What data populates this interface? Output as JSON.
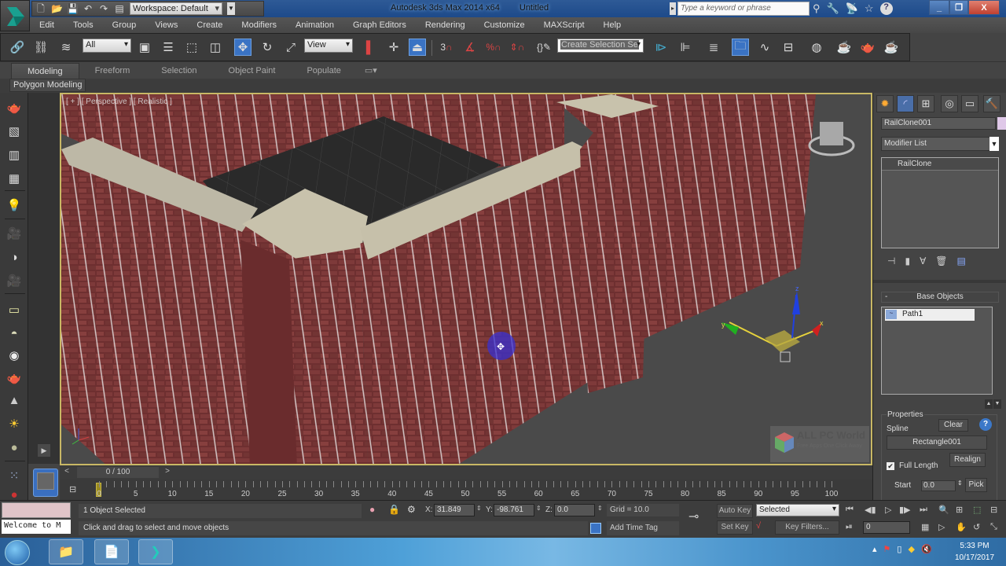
{
  "titlebar": {
    "app_title": "Autodesk 3ds Max  2014 x64",
    "document": "Untitled",
    "workspace": "Workspace: Default",
    "search_placeholder": "Type a keyword or phrase",
    "quick_access": [
      "new-icon",
      "open-icon",
      "save-icon",
      "undo-icon",
      "redo-icon",
      "project-folder-icon"
    ],
    "info_icons": [
      "binoculars-icon",
      "wrench-icon",
      "satellite-icon",
      "star-icon",
      "help-icon"
    ],
    "window_buttons": {
      "minimize": "_",
      "restore": "❐",
      "close": "X"
    }
  },
  "menubar": {
    "items": [
      "Edit",
      "Tools",
      "Group",
      "Views",
      "Create",
      "Modifiers",
      "Animation",
      "Graph Editors",
      "Rendering",
      "Customize",
      "MAXScript",
      "Help"
    ]
  },
  "toolbar": {
    "selection_filter": "All",
    "reference_coord": "View",
    "named_selection": "Create Selection Se",
    "snap_value": "3"
  },
  "ribbon": {
    "tabs": [
      "Modeling",
      "Freeform",
      "Selection",
      "Object Paint",
      "Populate"
    ],
    "active_tab": "Modeling",
    "panel_label": "Polygon Modeling"
  },
  "viewport": {
    "label": "[ + ] [ Perspective ] [ Realistic ]",
    "gizmo_axes": {
      "x": "x",
      "y": "y",
      "z": "z"
    },
    "watermark_title": "ALL PC World",
    "watermark_sub": "Free Apps One Click Away"
  },
  "command_panel": {
    "object_name": "RailClone001",
    "object_color": "#dfc8e8",
    "modifier_list": "Modifier List",
    "stack": [
      "RailClone"
    ],
    "base_objects_title": "Base Objects",
    "base_objects": [
      "Path1"
    ],
    "properties_title": "Properties",
    "spline_label": "Spline",
    "clear_label": "Clear",
    "spline_value": "Rectangle001",
    "realign_label": "Realign",
    "full_length_label": "Full Length",
    "full_length_checked": true,
    "start_label": "Start",
    "start_value": "0.0",
    "pick_label": "Pick"
  },
  "timeline": {
    "frame_display": "0 / 100",
    "prev": "<",
    "next": ">",
    "current_frame": 0,
    "total_frames": 100,
    "tick_labels": [
      "0",
      "5",
      "10",
      "15",
      "20",
      "25",
      "30",
      "35",
      "40",
      "45",
      "50",
      "55",
      "60",
      "65",
      "70",
      "75",
      "80",
      "85",
      "90",
      "95",
      "100"
    ]
  },
  "status": {
    "maxscript_text": "Welcome to M",
    "selection": "1 Object Selected",
    "prompt": "Click and drag to select and move objects",
    "x_label": "X:",
    "x": "31.849",
    "y_label": "Y:",
    "y": "-98.761",
    "z_label": "Z:",
    "z": "0.0",
    "grid": "Grid = 10.0",
    "add_time_tag": "Add Time Tag",
    "auto_key": "Auto Key",
    "set_key": "Set Key",
    "key_mode": "Selected",
    "key_filters": "Key Filters...",
    "frame_field": "0"
  },
  "taskbar": {
    "time": "5:33 PM",
    "date": "10/17/2017"
  }
}
